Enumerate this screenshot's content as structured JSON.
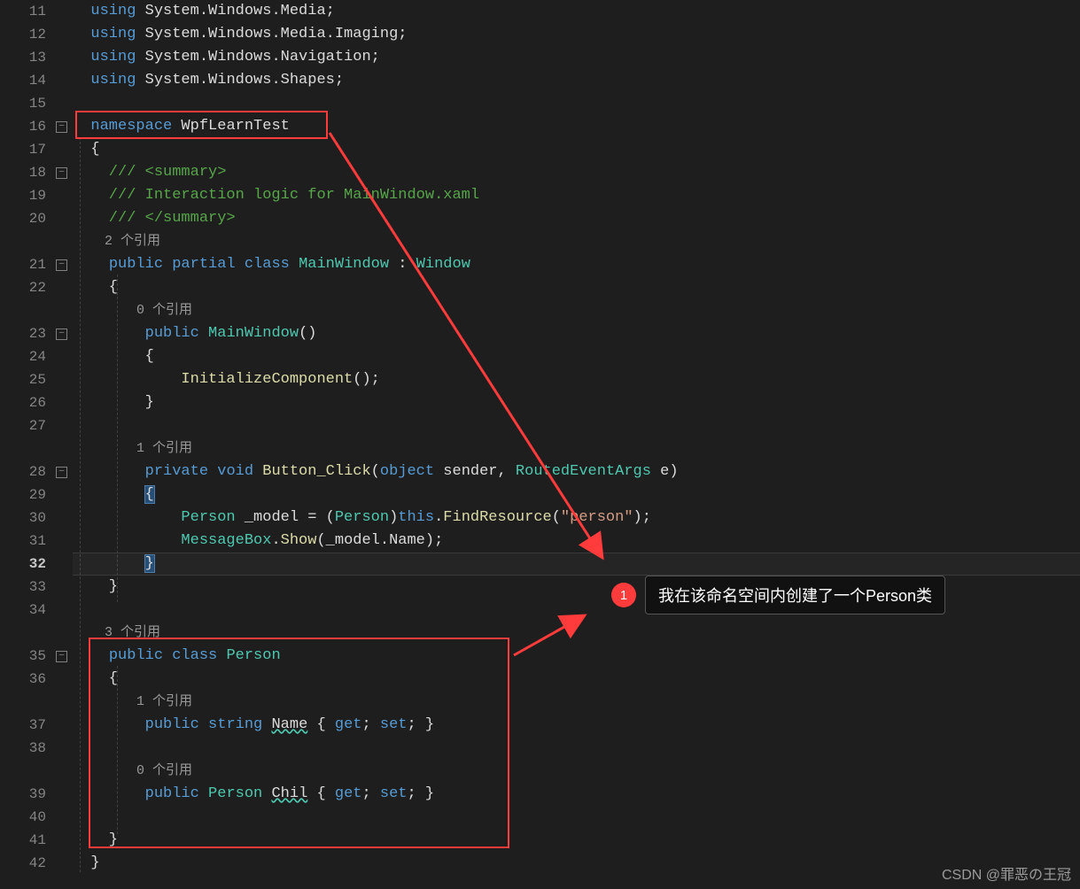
{
  "lineNumbers": [
    "11",
    "12",
    "13",
    "14",
    "15",
    "16",
    "17",
    "18",
    "19",
    "20",
    "21",
    "22",
    "23",
    "24",
    "25",
    "26",
    "27",
    "28",
    "29",
    "30",
    "31",
    "32",
    "33",
    "34",
    "35",
    "36",
    "37",
    "38",
    "39",
    "40",
    "41",
    "42"
  ],
  "codelens": {
    "l20b": "    2 个引用",
    "l22b": "        0 个引用",
    "l27b": "        1 个引用",
    "l34b": "    3 个引用",
    "l36b": "        1 个引用",
    "l38b": "        0 个引用"
  },
  "code": {
    "l11": {
      "kw": "using",
      "rest": " System.Windows.Media;"
    },
    "l12": {
      "kw": "using",
      "rest": " System.Windows.Media.Imaging;"
    },
    "l13": {
      "kw": "using",
      "rest": " System.Windows.Navigation;"
    },
    "l14": {
      "kw": "using",
      "rest": " System.Windows.Shapes;"
    },
    "l16": {
      "kw": "namespace",
      "name": " WpfLearnTest"
    },
    "l17": "{",
    "l18": "    /// <summary>",
    "l19": "    /// Interaction logic for MainWindow.xaml",
    "l20": "    /// </summary>",
    "l21": {
      "pre": "    ",
      "mods": "public partial class ",
      "name": "MainWindow",
      "post": " : ",
      "base": "Window"
    },
    "l22": "    {",
    "l23": {
      "pre": "        ",
      "mod": "public ",
      "name": "MainWindow",
      "post": "()"
    },
    "l24": "        {",
    "l25": {
      "pre": "            ",
      "call": "InitializeComponent",
      "post": "();"
    },
    "l26": "        }",
    "l28": {
      "pre": "        ",
      "mods": "private void ",
      "name": "Button_Click",
      "sig1": "(",
      "t1": "object",
      "a1": " sender, ",
      "t2": "RoutedEventArgs",
      "a2": " e)"
    },
    "l29": "        {",
    "l30": {
      "pre": "            ",
      "t1": "Person",
      "v": " _model = (",
      "t2": "Person",
      "p1": ")",
      "th": "this",
      "p2": ".",
      "m": "FindResource",
      "p3": "(",
      "s": "\"person\"",
      "p4": ");"
    },
    "l31": {
      "pre": "            ",
      "t": "MessageBox",
      "p1": ".",
      "m": "Show",
      "p2": "(_model.Name);"
    },
    "l32": "        }",
    "l33": "    }",
    "l35": {
      "pre": "    ",
      "mods": "public class ",
      "name": "Person"
    },
    "l36": "    {",
    "l37": {
      "pre": "        ",
      "mod": "public ",
      "t": "string",
      "sp": " ",
      "n": "Name",
      "post": " { ",
      "g": "get",
      "sc1": "; ",
      "s2": "set",
      "sc2": "; }"
    },
    "l39": {
      "pre": "        ",
      "mod": "public ",
      "t": "Person",
      "sp": " ",
      "n": "Chil",
      "post": " { ",
      "g": "get",
      "sc1": "; ",
      "s2": "set",
      "sc2": "; }"
    },
    "l41": "    }",
    "l42": "}"
  },
  "callout": {
    "num": "1",
    "text": "我在该命名空间内创建了一个Person类"
  },
  "watermark": "CSDN @罪恶の王冠"
}
